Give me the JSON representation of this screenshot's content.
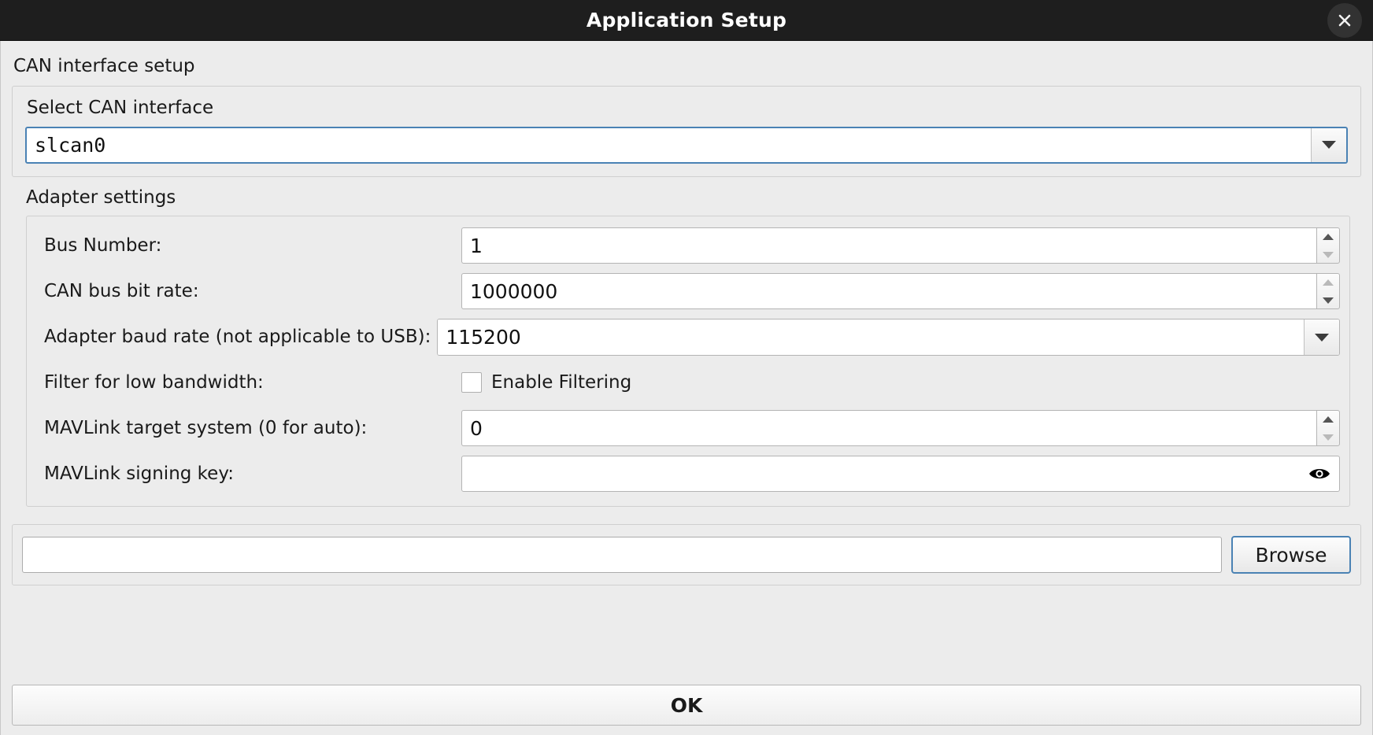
{
  "window": {
    "title": "Application Setup",
    "close_icon": "close-icon"
  },
  "can_section": {
    "heading": "CAN interface setup",
    "select_label": "Select CAN interface",
    "interface_value": "slcan0",
    "dropdown_icon": "chevron-down-icon"
  },
  "adapter_section": {
    "heading": "Adapter settings",
    "rows": [
      {
        "label": "Bus Number:",
        "value": "1",
        "type": "spinbox"
      },
      {
        "label": "CAN bus bit rate:",
        "value": "1000000",
        "type": "spinbox"
      },
      {
        "label": "Adapter baud rate (not applicable to USB):",
        "value": "115200",
        "type": "combobox"
      },
      {
        "label": "Filter for low bandwidth:",
        "value": "Enable Filtering",
        "checked": false,
        "type": "checkbox"
      },
      {
        "label": "MAVLink target system (0 for auto):",
        "value": "0",
        "type": "spinbox"
      },
      {
        "label": "MAVLink signing key:",
        "value": "",
        "type": "password",
        "reveal_icon": "eye-icon"
      }
    ]
  },
  "browse_section": {
    "path_value": "",
    "browse_label": "Browse"
  },
  "footer": {
    "ok_label": "OK"
  },
  "colors": {
    "titlebar_bg": "#1e1e1e",
    "dialog_bg": "#ececec",
    "focus_blue": "#4a82b4",
    "text": "#1a1a1a"
  }
}
